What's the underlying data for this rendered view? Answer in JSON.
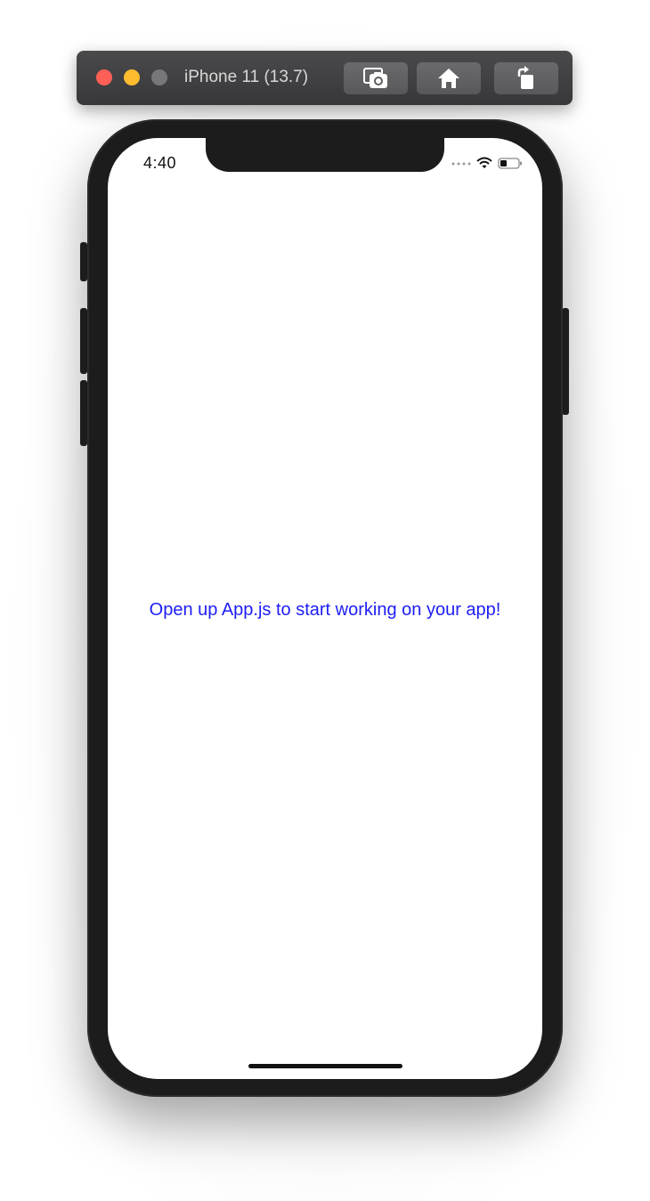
{
  "simulator": {
    "title": "iPhone 11 (13.7)",
    "traffic_lights": {
      "close_color": "#fe5f57",
      "minimize_color": "#febc2e",
      "zoom_color": "#77777a"
    },
    "toolbar": {
      "screenshot_icon": "camera-icon",
      "home_icon": "home-icon",
      "rotate_icon": "rotate-icon"
    }
  },
  "status_bar": {
    "time": "4:40",
    "icons": [
      "signal-dots-icon",
      "wifi-icon",
      "battery-icon"
    ]
  },
  "app": {
    "message": "Open up App.js to start working on your app!",
    "text_color": "#1d1df5",
    "background_color": "#ffffff"
  }
}
